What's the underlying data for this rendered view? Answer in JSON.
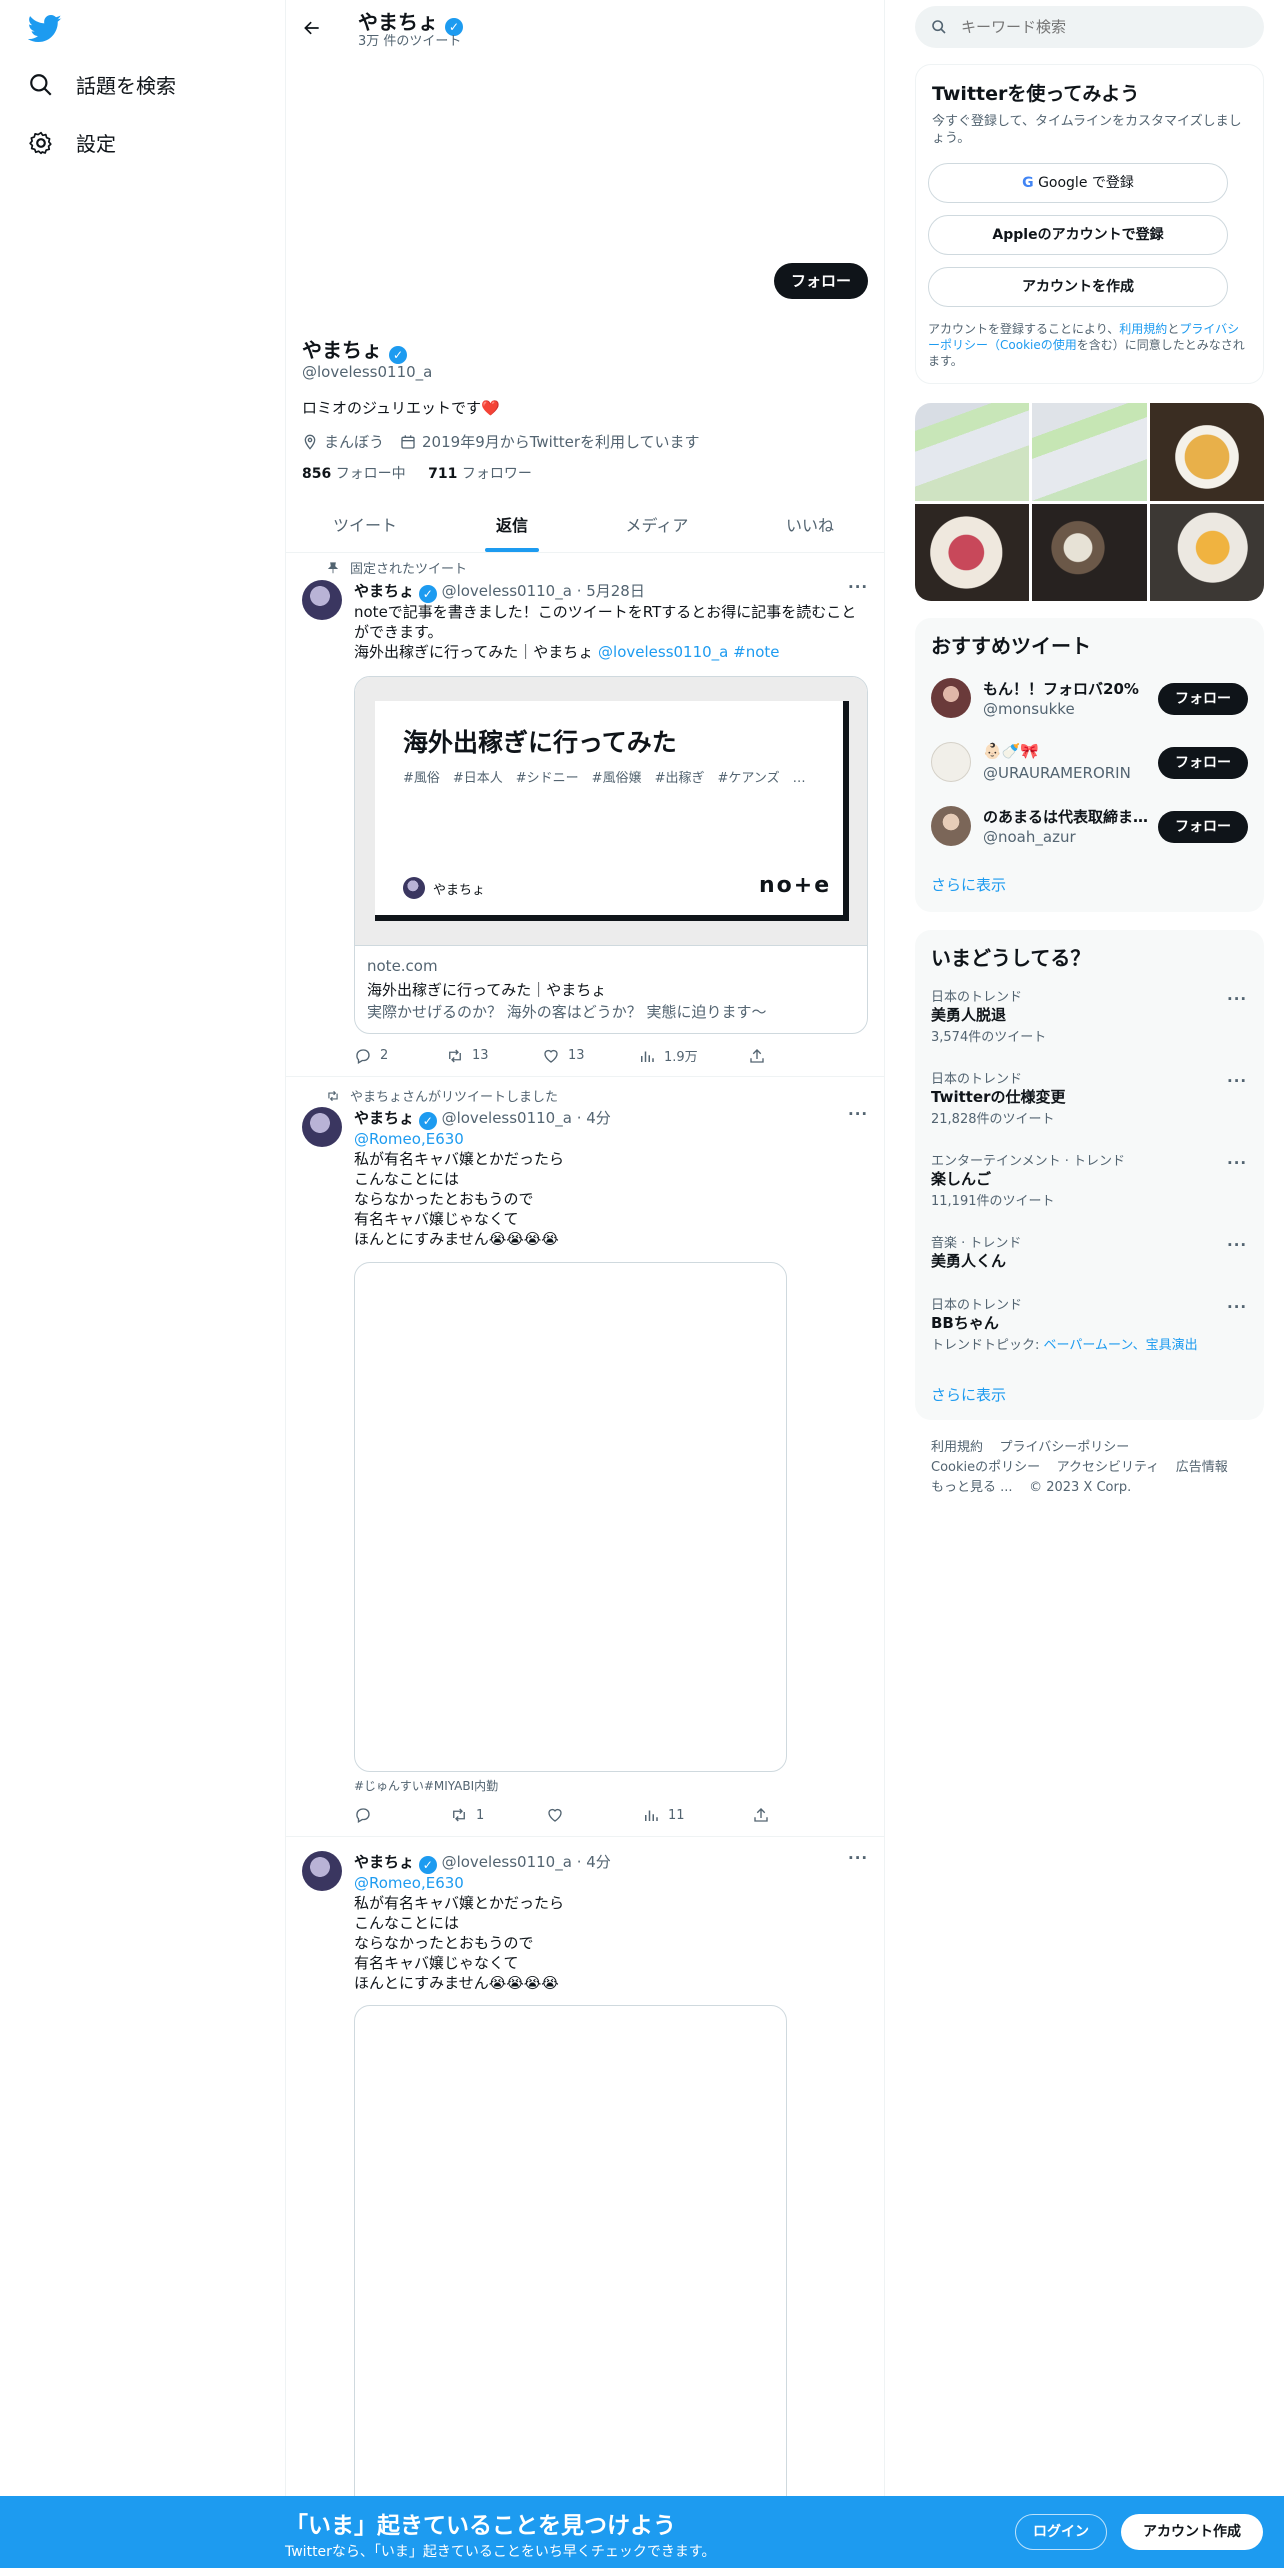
{
  "nav": {
    "explore_label": "話題を検索",
    "settings_label": "設定"
  },
  "profile": {
    "header_name": "やまちょ",
    "header_tweet_count": "3万 件のツイート",
    "follow_button": "フォロー",
    "name": "やまちょ",
    "handle": "@loveless0110_a",
    "bio": "ロミオのジュリエットです",
    "bio_emoji": "❤️",
    "location": "まんぼう",
    "joined": "2019年9月からTwitterを利用しています",
    "following_count": "856",
    "following_label": "フォロー中",
    "followers_count": "711",
    "followers_label": "フォロワー"
  },
  "tabs": [
    {
      "label": "ツイート"
    },
    {
      "label": "返信"
    },
    {
      "label": "メディア"
    },
    {
      "label": "いいね"
    }
  ],
  "tweets": [
    {
      "pinned_label": "固定されたツイート",
      "name": "やまちょ",
      "handle_time": "@loveless0110_a · 5月28日",
      "text": "noteで記事を書きました！このツイートをRTするとお得に記事を読むことができます。",
      "text2_plain": "海外出稼ぎに行ってみた｜やまちょ ",
      "text2_mention": "@loveless0110_a",
      "text2_tag": "#note",
      "card": {
        "image_title": "海外出稼ぎに行ってみた",
        "image_tags": "#風俗　#日本人　#シドニー　#風俗嬢　#出稼ぎ　#ケアンズ　…",
        "image_author": "やまちょ",
        "image_brand": "no+e",
        "domain": "note.com",
        "title": "海外出稼ぎに行ってみた｜やまちょ",
        "description": "実際かせげるのか？ 海外の客はどうか？ 実態に迫ります〜"
      },
      "replies": "2",
      "retweets": "13",
      "likes": "13",
      "views": "1.9万"
    },
    {
      "retweet_label": "やまちょさんがリツイートしました",
      "name": "やまちょ",
      "handle_time": "@loveless0110_a · 4分",
      "reply_to": "@Romeo,E630",
      "lines": [
        "私が有名キャバ嬢とかだったら",
        "こんなことには",
        "ならなかったとおもうので",
        "有名キャバ嬢じゃなくて",
        "ほんとにすみません😭😭😭😭"
      ],
      "hashtags": "#じゅんすい#MIYABI内勤",
      "replies": "",
      "retweets": "1",
      "likes": "",
      "views": "11"
    },
    {
      "name": "やまちょ",
      "handle_time": "@loveless0110_a · 4分",
      "reply_to": "@Romeo,E630",
      "lines": [
        "私が有名キャバ嬢とかだったら",
        "こんなことには",
        "ならなかったとおもうので",
        "有名キャバ嬢じゃなくて",
        "ほんとにすみません😭😭😭😭"
      ]
    }
  ],
  "search": {
    "placeholder": "キーワード検索"
  },
  "signup": {
    "title": "Twitterを使ってみよう",
    "subtitle": "今すぐ登録して、タイムラインをカスタマイズしましょう。",
    "google": "Google で登録",
    "apple": "Appleのアカウントで登録",
    "create": "アカウントを作成",
    "legal_1": "アカウントを登録することにより、",
    "legal_terms": "利用規約",
    "legal_2": "と",
    "legal_privacy": "プライバシーポリシー（Cookieの使用",
    "legal_3": "を含む）に同意したとみなされます。"
  },
  "who_to_follow": {
    "title": "おすすめツイート",
    "users": [
      {
        "name": "もん！！フォロバ20%",
        "handle": "@monsukke",
        "button": "フォロー"
      },
      {
        "name": "👶🏻🍼🎀",
        "handle": "@URAURAMERORIN",
        "button": "フォロー"
      },
      {
        "name": "のあまるは代表取締ま…",
        "handle": "@noah_azur",
        "button": "フォロー"
      }
    ],
    "show_more": "さらに表示"
  },
  "trends": {
    "title": "いまどうしてる？",
    "items": [
      {
        "context": "日本のトレンド",
        "name": "美勇人脱退",
        "count": "3,574件のツイート"
      },
      {
        "context": "日本のトレンド",
        "name": "Twitterの仕様変更",
        "count": "21,828件のツイート"
      },
      {
        "context": "エンターテインメント · トレンド",
        "name": "楽しんご",
        "count": "11,191件のツイート"
      },
      {
        "context": "音楽 · トレンド",
        "name": "美勇人くん",
        "count": ""
      },
      {
        "context": "日本のトレンド",
        "name": "BBちゃん",
        "topic_label": "トレンドトピック: ",
        "topic_links": "ベーパームーン、宝具演出"
      }
    ],
    "show_more": "さらに表示"
  },
  "footer": {
    "terms": "利用規約",
    "privacy": "プライバシーポリシー",
    "cookies": "Cookieのポリシー",
    "accessibility": "アクセシビリティ",
    "ads": "広告情報",
    "more": "もっと見る ...",
    "copyright": "© 2023 X Corp."
  },
  "bottom_bar": {
    "title": "「いま」起きていることを見つけよう",
    "subtitle": "Twitterなら、「いま」起きていることをいち早くチェックできます。",
    "login": "ログイン",
    "signup": "アカウント作成"
  },
  "colors": {
    "accent": "#1d9bf0",
    "text": "#0f1419",
    "muted": "#536471"
  }
}
